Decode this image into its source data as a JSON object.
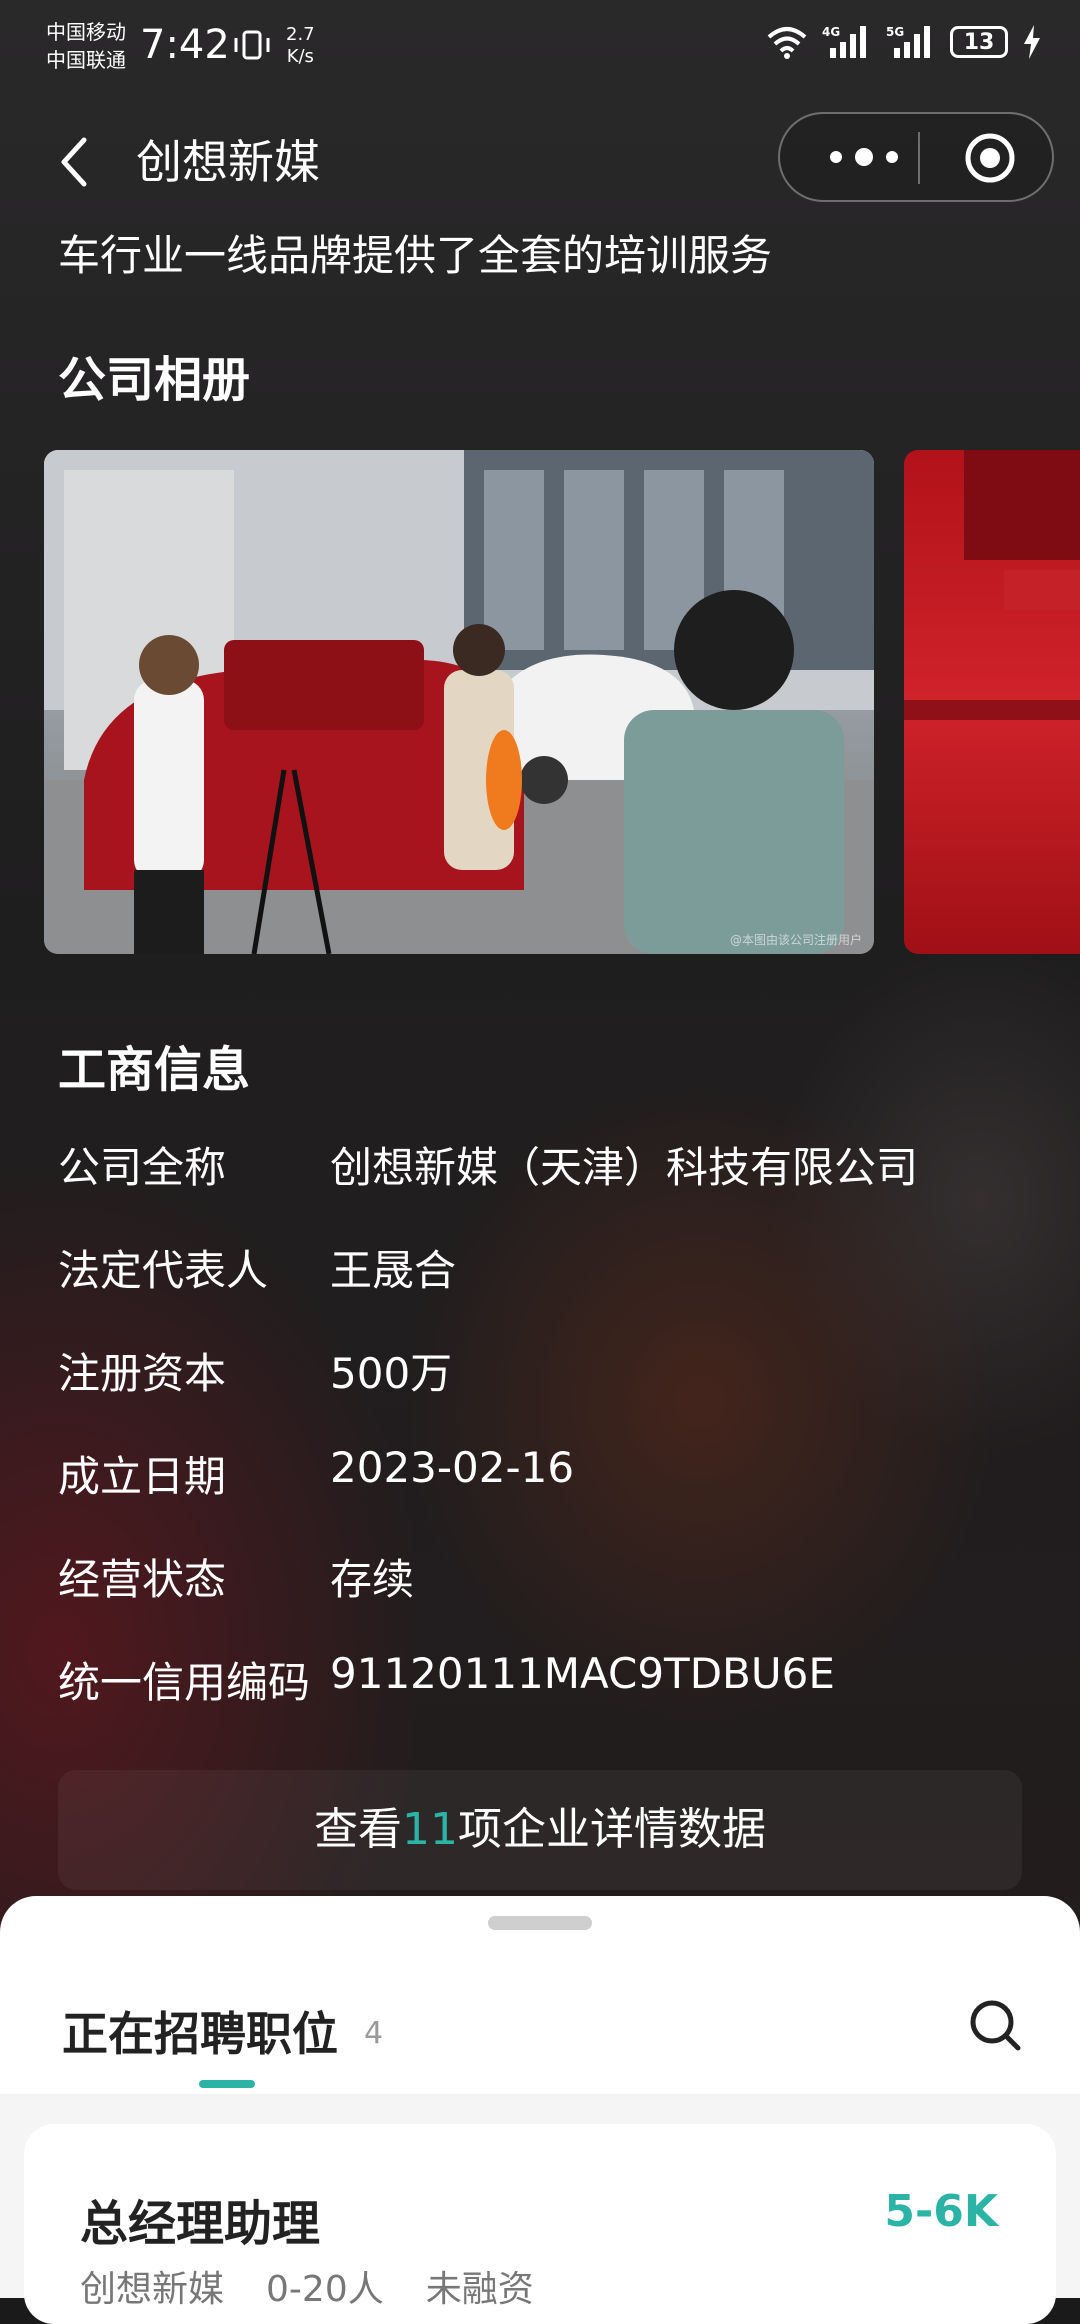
{
  "status_bar": {
    "carrier1": "中国移动",
    "carrier2": "中国联通",
    "time": "7:42",
    "speed_value": "2.7",
    "speed_unit": "K/s",
    "battery": "13"
  },
  "nav": {
    "title": "创想新媒"
  },
  "intro_text": "车行业一线品牌提供了全套的培训服务",
  "album": {
    "title": "公司相册",
    "watermark": "@本图由该公司注册用户"
  },
  "business": {
    "title": "工商信息",
    "rows": [
      {
        "label": "公司全称",
        "value": "创想新媒（天津）科技有限公司"
      },
      {
        "label": "法定代表人",
        "value": "王晟合"
      },
      {
        "label": "注册资本",
        "value": "500万"
      },
      {
        "label": "成立日期",
        "value": "2023-02-16"
      },
      {
        "label": "经营状态",
        "value": "存续"
      },
      {
        "label": "统一信用编码",
        "value": "91120111MAC9TDBU6E"
      }
    ],
    "detail_prefix": "查看",
    "detail_count": "11",
    "detail_suffix": "项企业详情数据"
  },
  "jobs": {
    "tab_label": "正在招聘职位",
    "tab_count": "4",
    "accent_color": "#2bb3a6",
    "first_job": {
      "title": "总经理助理",
      "salary": "5-6K",
      "company": "创想新媒",
      "size": "0-20人",
      "funding": "未融资"
    }
  }
}
